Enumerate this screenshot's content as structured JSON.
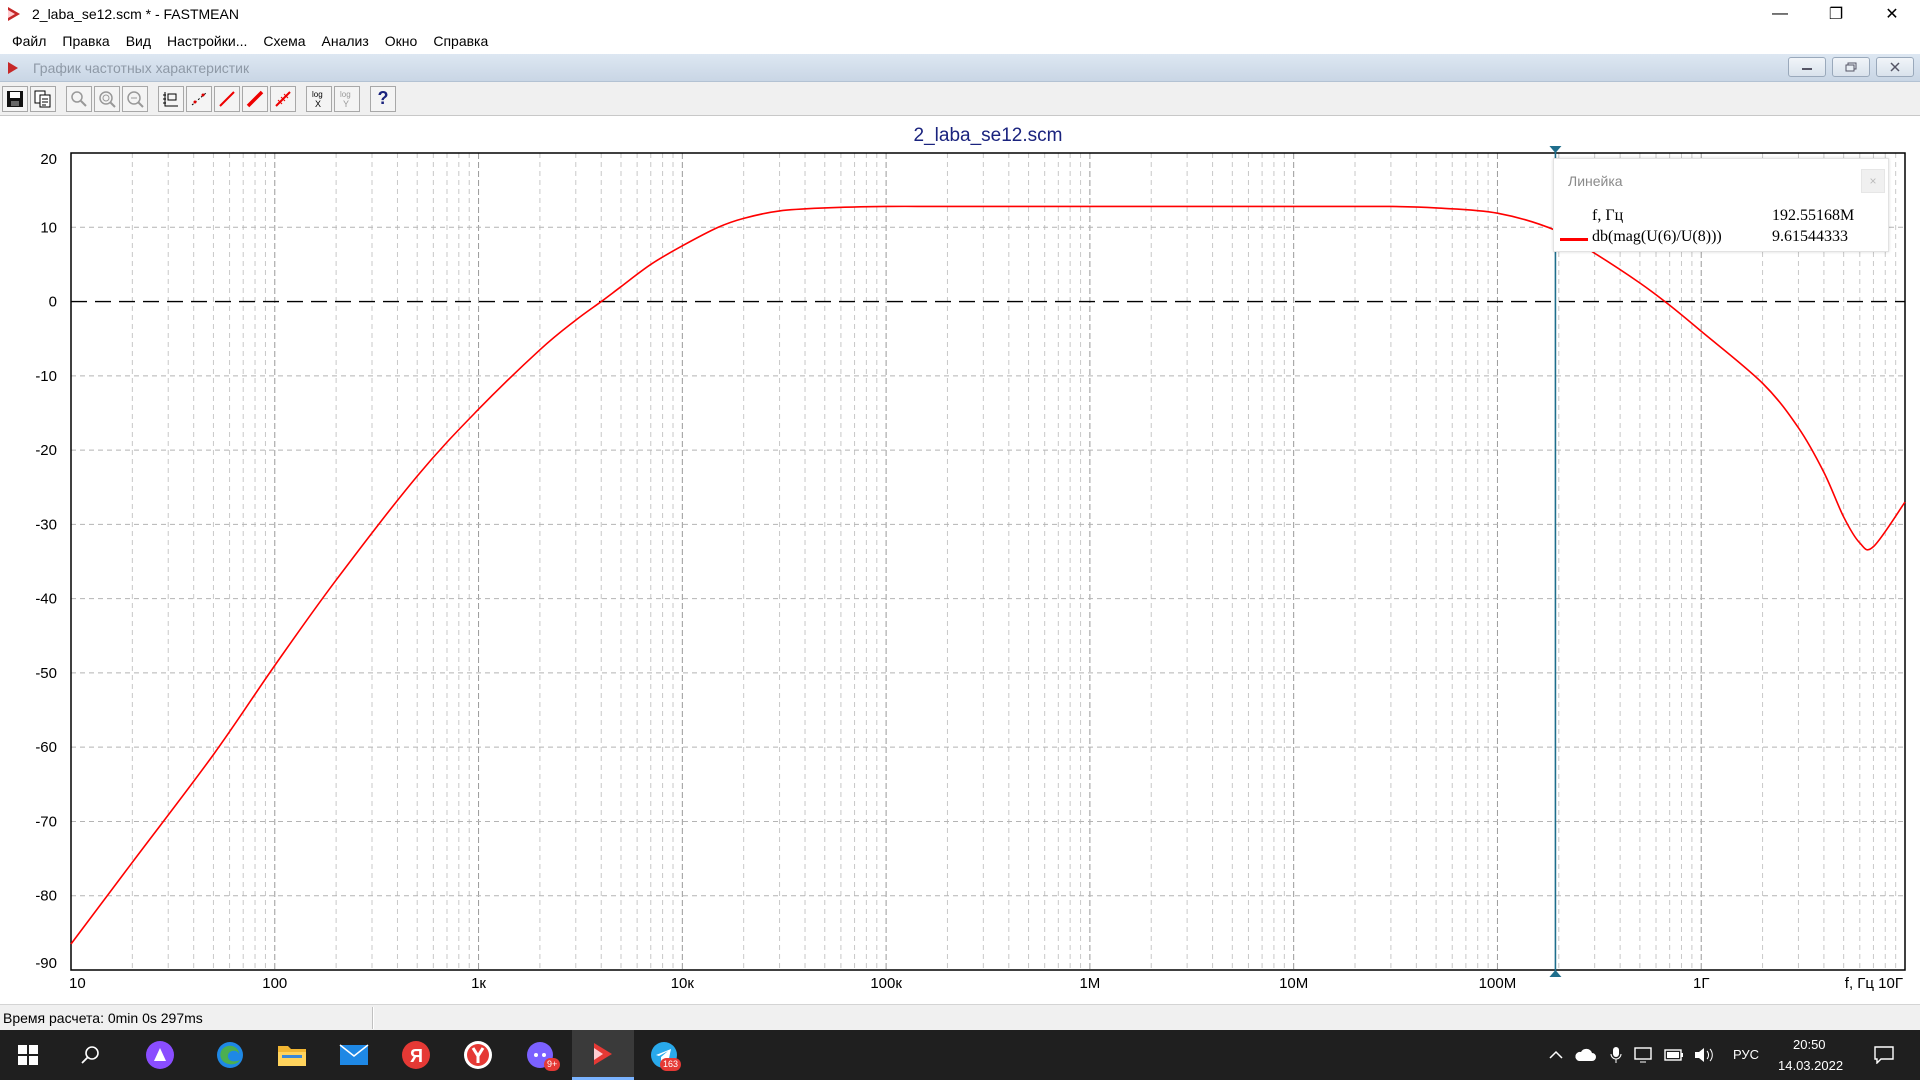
{
  "window": {
    "title": "2_laba_se12.scm * - FASTMEAN",
    "controls": {
      "minimize": "—",
      "restore": "❐",
      "close": "✕"
    }
  },
  "menu": {
    "items": [
      "Файл",
      "Правка",
      "Вид",
      "Настройки...",
      "Схема",
      "Анализ",
      "Окно",
      "Справка"
    ]
  },
  "child_window": {
    "title": "График частотных характеристик"
  },
  "toolbar": {
    "log_x_label": "log\nX",
    "log_y_label": "log\nY",
    "help_label": "?"
  },
  "chart_data": {
    "type": "line",
    "title": "2_laba_se12.scm",
    "x_scale": "log",
    "xlim": [
      10,
      10000000000
    ],
    "ylim": [
      -90,
      20
    ],
    "x_ticks": [
      10,
      100,
      1000,
      10000,
      100000,
      1000000,
      10000000,
      100000000,
      1000000000
    ],
    "x_tick_labels": [
      "10",
      "100",
      "1к",
      "10к",
      "100к",
      "1М",
      "10М",
      "100М",
      "1Г"
    ],
    "x_end_label": "f, Гц 10Г",
    "y_ticks": [
      20,
      10,
      0,
      -10,
      -20,
      -30,
      -40,
      -50,
      -60,
      -70,
      -80,
      -90
    ],
    "y_tick_labels": [
      "20",
      "10",
      "0",
      "-10",
      "-20",
      "-30",
      "-40",
      "-50",
      "-60",
      "-70",
      "-80",
      "-90"
    ],
    "grid": true,
    "reference_line": {
      "y": 0,
      "style": "dashed",
      "color": "#000000"
    },
    "cursor": {
      "x": 192551680
    },
    "series": [
      {
        "color": "#ff0000",
        "x": [
          10,
          20,
          50,
          100,
          200,
          500,
          1000,
          2000,
          3000,
          4000,
          5000,
          7000,
          10000,
          15000,
          20000,
          30000,
          50000,
          100000,
          200000,
          1000000,
          10000000,
          30000000,
          50000000,
          100000000,
          192551680,
          300000000,
          500000000,
          700000000,
          1000000000,
          2000000000,
          3000000000,
          4000000000,
          5000000000,
          6000000000,
          7000000000,
          10000000000
        ],
        "y": [
          -86.5,
          -75.5,
          -61,
          -49,
          -37.5,
          -23.5,
          -14.5,
          -6.5,
          -2.5,
          0,
          2,
          5,
          7.5,
          10,
          11.2,
          12.2,
          12.6,
          12.8,
          12.8,
          12.8,
          12.8,
          12.8,
          12.6,
          11.9,
          9.6,
          6.5,
          2.5,
          -0.5,
          -4,
          -11,
          -17,
          -23,
          -29,
          -32.5,
          -33,
          -27
        ]
      }
    ]
  },
  "ruler": {
    "title": "Линейка",
    "close_label": "×",
    "rows": [
      {
        "name": "f, Гц",
        "value": "192.55168M"
      },
      {
        "name": "db(mag(U(6)/U(8)))",
        "value": "9.61544333"
      }
    ]
  },
  "status": {
    "calc_time": "Время расчета: 0min 0s 297ms"
  },
  "taskbar": {
    "language": "РУС",
    "time": "20:50",
    "date": "14.03.2022",
    "badges": {
      "discord": "9+",
      "telegram": "163"
    }
  }
}
